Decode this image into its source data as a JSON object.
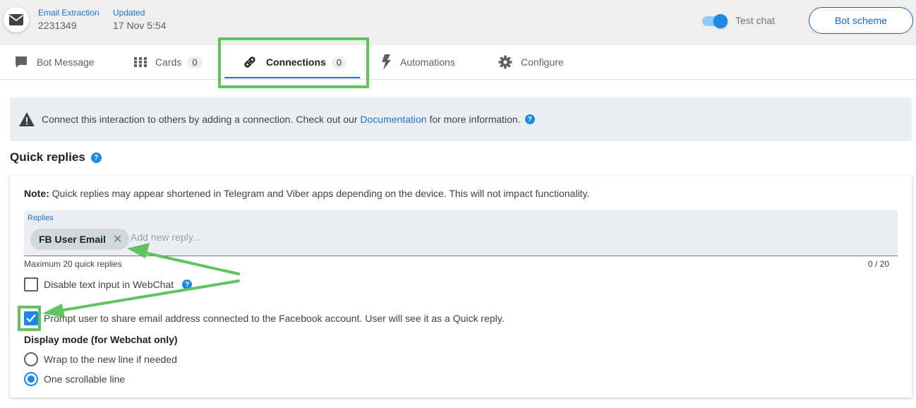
{
  "header": {
    "interaction_label": "Email Extraction",
    "interaction_id": "2231349",
    "updated_label": "Updated",
    "updated_value": "17 Nov 5:54",
    "test_chat_label": "Test chat",
    "test_chat_on": true,
    "bot_scheme_label": "Bot scheme",
    "icon": "envelope-icon"
  },
  "tabs": [
    {
      "label": "Bot Message",
      "icon": "speech-bubble-icon"
    },
    {
      "label": "Cards",
      "count": "0",
      "icon": "grid-icon"
    },
    {
      "label": "Connections",
      "count": "0",
      "icon": "link-icon",
      "active": true
    },
    {
      "label": "Automations",
      "icon": "lightning-icon"
    },
    {
      "label": "Configure",
      "icon": "gear-icon"
    }
  ],
  "banner": {
    "text_before": "Connect this interaction to others by adding a connection. Check out our ",
    "link": "Documentation",
    "text_after": " for more information."
  },
  "quick_replies": {
    "title": "Quick replies",
    "note_bold": "Note:",
    "note_text": " Quick replies may appear shortened in Telegram and Viber apps depending on the device. This will not impact functionality.",
    "replies_label": "Replies",
    "chips": [
      "FB User Email"
    ],
    "add_placeholder": "Add new reply...",
    "max_text": "Maximum 20 quick replies",
    "counter": "0 / 20",
    "disable_text_input_label": "Disable text input in WebChat",
    "disable_text_input_checked": false,
    "prompt_email_label": "Prompt user to share email address connected to the Facebook account. User will see it as a Quick reply.",
    "prompt_email_checked": true,
    "display_mode_title": "Display mode (for Webchat only)",
    "display_modes": [
      {
        "label": "Wrap to the new line if needed",
        "selected": false
      },
      {
        "label": "One scrollable line",
        "selected": true
      }
    ]
  },
  "colors": {
    "accent": "#1e88e5",
    "link": "#1976d2",
    "highlight": "#5fc35f"
  }
}
